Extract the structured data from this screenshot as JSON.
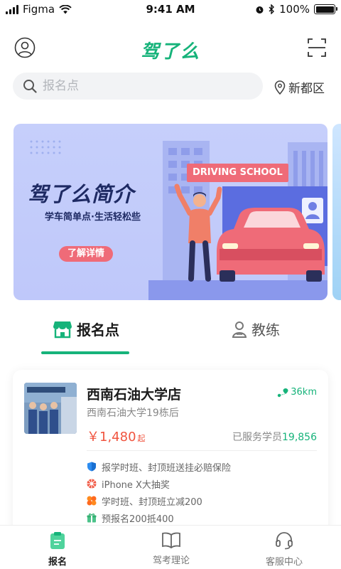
{
  "status_bar": {
    "carrier": "Figma",
    "time": "9:41 AM",
    "battery": "100%",
    "battery_level": 1.0
  },
  "header": {
    "logo_text": "驾了么",
    "brand_color": "#16b37a"
  },
  "search": {
    "placeholder": "报名点",
    "location": "新都区"
  },
  "banner": {
    "title": "驾了么简介",
    "subtitle": "学车简单点·生活轻松些",
    "button_label": "了解详情",
    "tag": "DRIVING SCHOOL"
  },
  "tabs": [
    {
      "label": "报名点",
      "active": true
    },
    {
      "label": "教练",
      "active": false
    }
  ],
  "card": {
    "name": "西南石油大学店",
    "distance": "36km",
    "address": "西南石油大学19栋后",
    "price": "￥1,480",
    "price_unit": "起",
    "served_label": "已服务学员",
    "served_count": "19,856",
    "promos": [
      {
        "icon": "shield-icon",
        "text": "报学时班、封顶班送挂必赔保险"
      },
      {
        "icon": "lottery-icon",
        "text": "iPhone X大抽奖"
      },
      {
        "icon": "discount-icon",
        "text": "学时班、封顶班立减200"
      },
      {
        "icon": "gift-icon",
        "text": "预报名200抵400"
      }
    ]
  },
  "bottom_nav": [
    {
      "label": "报名",
      "icon": "clipboard-icon",
      "active": true
    },
    {
      "label": "驾考理论",
      "icon": "book-icon",
      "active": false
    },
    {
      "label": "客服中心",
      "icon": "headset-icon",
      "active": false
    }
  ],
  "colors": {
    "accent": "#16b37a",
    "price": "#f0543f",
    "banner_bg": "#c6cffb",
    "banner_button": "#ef6b78"
  }
}
